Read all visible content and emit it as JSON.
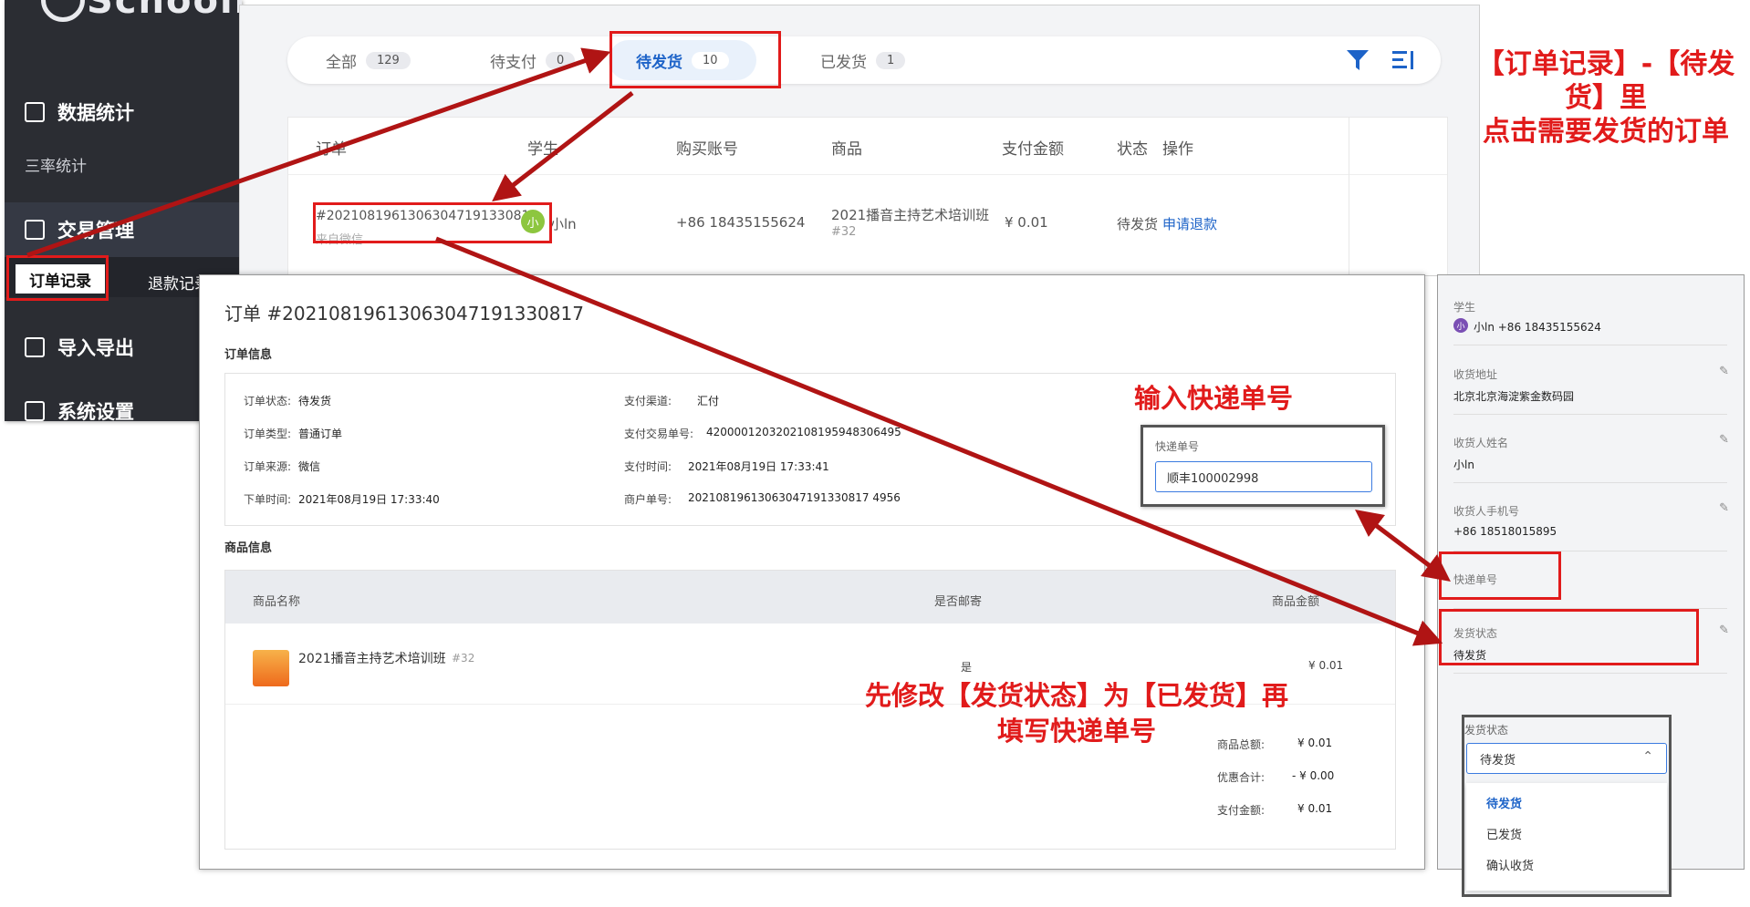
{
  "sidebar": {
    "logo": "Schoolin",
    "groups": [
      {
        "label": "数据统计",
        "icon": "chart-icon"
      },
      {
        "label": "交易管理",
        "icon": "receipt-icon"
      },
      {
        "label": "导入导出",
        "icon": "import-export-icon"
      },
      {
        "label": "系统设置",
        "icon": "settings-icon"
      }
    ],
    "sub_stats": "三率统计",
    "sub_orders": "订单记录",
    "sub_refunds": "退款记录"
  },
  "tabs": [
    {
      "label": "全部",
      "count": "129"
    },
    {
      "label": "待支付",
      "count": "0"
    },
    {
      "label": "待发货",
      "count": "10"
    },
    {
      "label": "已发货",
      "count": "1"
    }
  ],
  "table": {
    "headers": [
      "订单",
      "学生",
      "购买账号",
      "商品",
      "支付金额",
      "状态",
      "操作"
    ],
    "row": {
      "order_no": "#202108196130630471913308 17",
      "order_no_full": "#20210819613063047191330817",
      "source": "来自微信",
      "avatar": "小",
      "student": "小ln",
      "account": "+86 18435155624",
      "product": "2021播音主持艺术培训班",
      "product_id": "#32",
      "amount": "¥ 0.01",
      "status": "待发货",
      "action": "申请退款"
    }
  },
  "detail": {
    "title": "订单 #20210819613063047191330817",
    "order_info_heading": "订单信息",
    "info": {
      "status_label": "订单状态:",
      "status": "待发货",
      "type_label": "订单类型:",
      "type": "普通订单",
      "source_label": "订单来源:",
      "source": "微信",
      "time_label": "下单时间:",
      "time": "2021年08月19日 17:33:40",
      "channel_label": "支付渠道:",
      "channel": "汇付",
      "trade_no_label": "支付交易单号:",
      "trade_no": "4200001203202108195948306495",
      "pay_time_label": "支付时间:",
      "pay_time": "2021年08月19日 17:33:41",
      "merchant_no_label": "商户单号:",
      "merchant_no": "20210819613063047191330817 4956"
    },
    "goods_heading": "商品信息",
    "goods_headers": [
      "商品名称",
      "是否邮寄",
      "商品金额"
    ],
    "goods": {
      "name": "2021播音主持艺术培训班",
      "id": "#32",
      "mail": "是",
      "price": "¥ 0.01"
    },
    "totals": [
      {
        "label": "商品总额:",
        "value": "¥ 0.01"
      },
      {
        "label": "优惠合计:",
        "value": "- ¥ 0.00"
      },
      {
        "label": "支付金额:",
        "value": "¥ 0.01"
      }
    ],
    "express": {
      "label": "快递单号",
      "value": "顺丰100002998"
    }
  },
  "right": {
    "student_label": "学生",
    "student_avatar": "小",
    "student": "小ln +86 18435155624",
    "address_label": "收货地址",
    "address": "北京北京海淀紫金数码园",
    "receiver_label": "收货人姓名",
    "receiver": "小ln",
    "phone_label": "收货人手机号",
    "phone": "+86 18518015895",
    "express_label": "快递单号",
    "ship_label": "发货状态",
    "ship": "待发货",
    "dropdown_label": "发货状态",
    "dropdown_value": "待发货",
    "options": [
      "待发货",
      "已发货",
      "确认收货"
    ]
  },
  "annotations": {
    "top_right_1": "【订单记录】-【待发",
    "top_right_2": "货】里",
    "top_right_3": "点击需要发货的订单",
    "express": "输入快递单号",
    "modify_1": "先修改【发货状态】为【已发货】再",
    "modify_2": "填写快递单号"
  },
  "colors": {
    "accent": "#1d63c8",
    "annotation": "#e11b1b",
    "sidebar": "#2b2d33"
  }
}
